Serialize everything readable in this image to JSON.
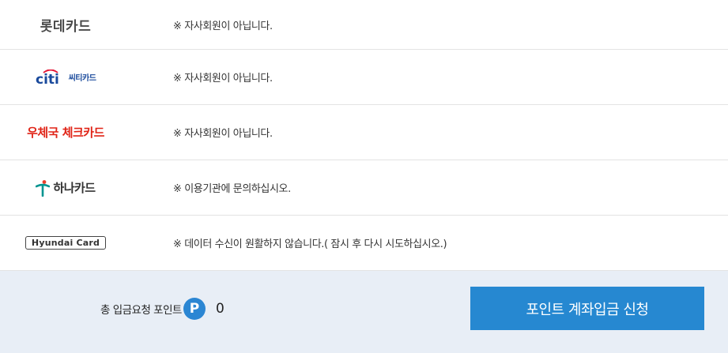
{
  "rows": [
    {
      "card": "롯데카드",
      "message": "※ 자사회원이 아닙니다."
    },
    {
      "card_word": "citi",
      "card_sub": "씨티카드",
      "message": "※ 자사회원이 아닙니다."
    },
    {
      "card": "우체국 체크카드",
      "message": "※ 자사회원이 아닙니다."
    },
    {
      "card": "하나카드",
      "message": "※ 이용기관에 문의하십시오."
    },
    {
      "card": "Hyundai Card",
      "message": "※ 데이터 수신이 원활하지 않습니다.( 잠시 후 다시 시도하십시오.)"
    }
  ],
  "footer": {
    "total_label": "총 입금요청 포인트",
    "point_badge": "P",
    "total_value": "0",
    "submit_label": "포인트 계좌입금 신청"
  },
  "colors": {
    "accent": "#2688d1",
    "footer_bg": "#e8eef6",
    "citi_blue": "#1a4a9c",
    "citi_red": "#e31837",
    "post_red": "#e02417",
    "hana_green": "#009490"
  }
}
